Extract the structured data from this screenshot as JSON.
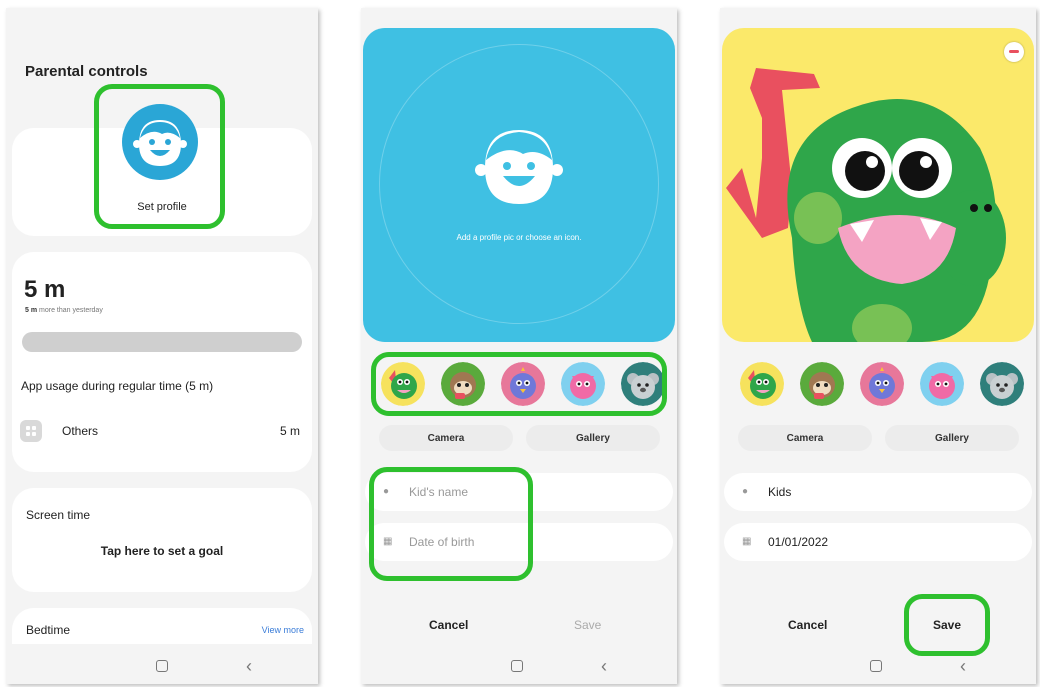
{
  "screen1": {
    "title": "Parental controls",
    "set_profile_label": "Set profile",
    "usage_value": "5 m",
    "usage_compare_bold": "5 m",
    "usage_compare_rest": "more than yesterday",
    "app_usage_title": "App usage during regular time (5 m)",
    "app_row_label": "Others",
    "app_row_value": "5 m",
    "screen_time_title": "Screen time",
    "screen_time_action": "Tap here to set a goal",
    "bedtime_title": "Bedtime",
    "view_more": "View more"
  },
  "screen2": {
    "hint": "Add a profile pic or choose an icon.",
    "camera_label": "Camera",
    "gallery_label": "Gallery",
    "name_placeholder": "Kid's name",
    "dob_placeholder": "Date of birth",
    "cancel_label": "Cancel",
    "save_label": "Save"
  },
  "screen3": {
    "camera_label": "Camera",
    "gallery_label": "Gallery",
    "name_value": "Kids",
    "dob_value": "01/01/2022",
    "cancel_label": "Cancel",
    "save_label": "Save"
  },
  "colors": {
    "highlight": "#2ec02e",
    "profile_blue": "#3fc0e3",
    "link_blue": "#3b7dd8",
    "dino_green": "#2fa64a",
    "preview_yellow": "#fbe96a"
  },
  "icons": [
    "kid-face-icon",
    "person-icon",
    "calendar-icon",
    "grid-icon",
    "remove-icon",
    "home-icon",
    "back-icon"
  ]
}
